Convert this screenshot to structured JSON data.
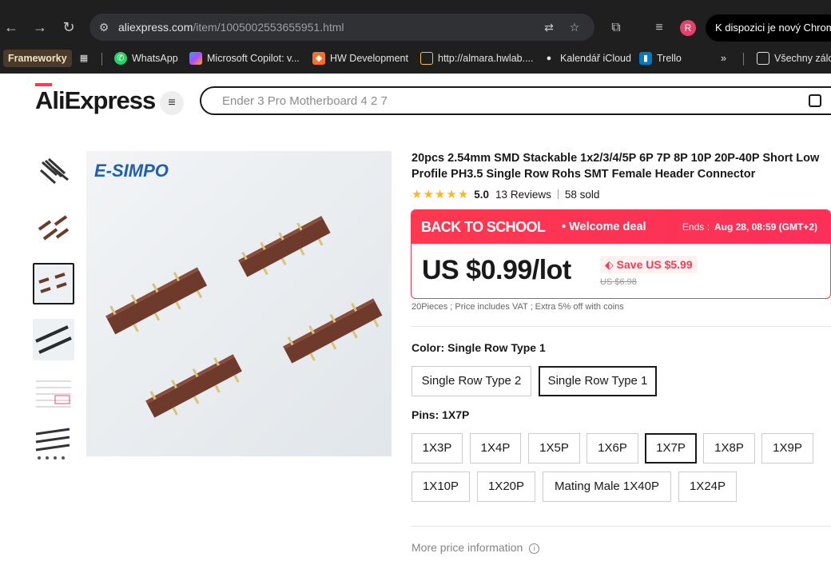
{
  "browser": {
    "url_domain": "aliexpress.com",
    "url_path": "/item/1005002553655951.html",
    "profile_initial": "R",
    "update_banner": "K dispozici je nový Chrome",
    "bookmarks": [
      {
        "label": "Frameworky",
        "icon": "folder-icon"
      },
      {
        "label": "WhatsApp",
        "icon": "whatsapp-icon"
      },
      {
        "label": "Microsoft Copilot: v...",
        "icon": "copilot-icon"
      },
      {
        "label": "HW Development",
        "icon": "gitlab-icon"
      },
      {
        "label": "http://almara.hwlab....",
        "icon": "page-icon"
      },
      {
        "label": "Kalendář iCloud",
        "icon": "apple-icon"
      },
      {
        "label": "Trello",
        "icon": "trello-icon"
      },
      {
        "label": "Všechny zálo",
        "icon": "folder-icon"
      }
    ]
  },
  "header": {
    "logo_text": "AliExpress",
    "search_placeholder": "Ender 3 Pro Motherboard 4 2 7"
  },
  "gallery": {
    "thumbnails": [
      "thumb-1",
      "thumb-2",
      "thumb-3",
      "thumb-4",
      "thumb-5",
      "thumb-6"
    ],
    "selected_index": 2,
    "brand_watermark": "E-SIMPO"
  },
  "product": {
    "title": "20pcs 2.54mm SMD Stackable 1x2/3/4/5P 6P 7P 8P 10P 20P-40P Short Low Profile PH3.5 Single Row Rohs SMT Female Header Connector",
    "rating": "5.0",
    "reviews": "13 Reviews",
    "sold": "58 sold",
    "stars": 5
  },
  "deal": {
    "name": "BACK TO SCHOOL",
    "subtitle": "• Welcome deal",
    "ends_label": "Ends :",
    "ends_value": "Aug 28, 08:59 (GMT+2)",
    "price": "US $0.99/lot",
    "save": "Save US $5.99",
    "old_price": "US $6.98",
    "note": "20Pieces ; Price includes VAT ; Extra 5% off with coins"
  },
  "color": {
    "label": "Color: Single Row Type 1",
    "options": [
      {
        "label": "Single Row Type 2",
        "selected": false
      },
      {
        "label": "Single Row Type 1",
        "selected": true
      }
    ]
  },
  "pins": {
    "label": "Pins: 1X7P",
    "options": [
      {
        "label": "1X3P",
        "selected": false
      },
      {
        "label": "1X4P",
        "selected": false
      },
      {
        "label": "1X5P",
        "selected": false
      },
      {
        "label": "1X6P",
        "selected": false
      },
      {
        "label": "1X7P",
        "selected": true
      },
      {
        "label": "1X8P",
        "selected": false
      },
      {
        "label": "1X9P",
        "selected": false
      },
      {
        "label": "1X10P",
        "selected": false
      },
      {
        "label": "1X20P",
        "selected": false
      },
      {
        "label": "Mating Male 1X40P",
        "selected": false
      },
      {
        "label": "1X24P",
        "selected": false
      }
    ]
  },
  "more_price": "More price information",
  "colors": {
    "accent": "#fd384f",
    "star": "#fdb71f",
    "text": "#191919"
  }
}
